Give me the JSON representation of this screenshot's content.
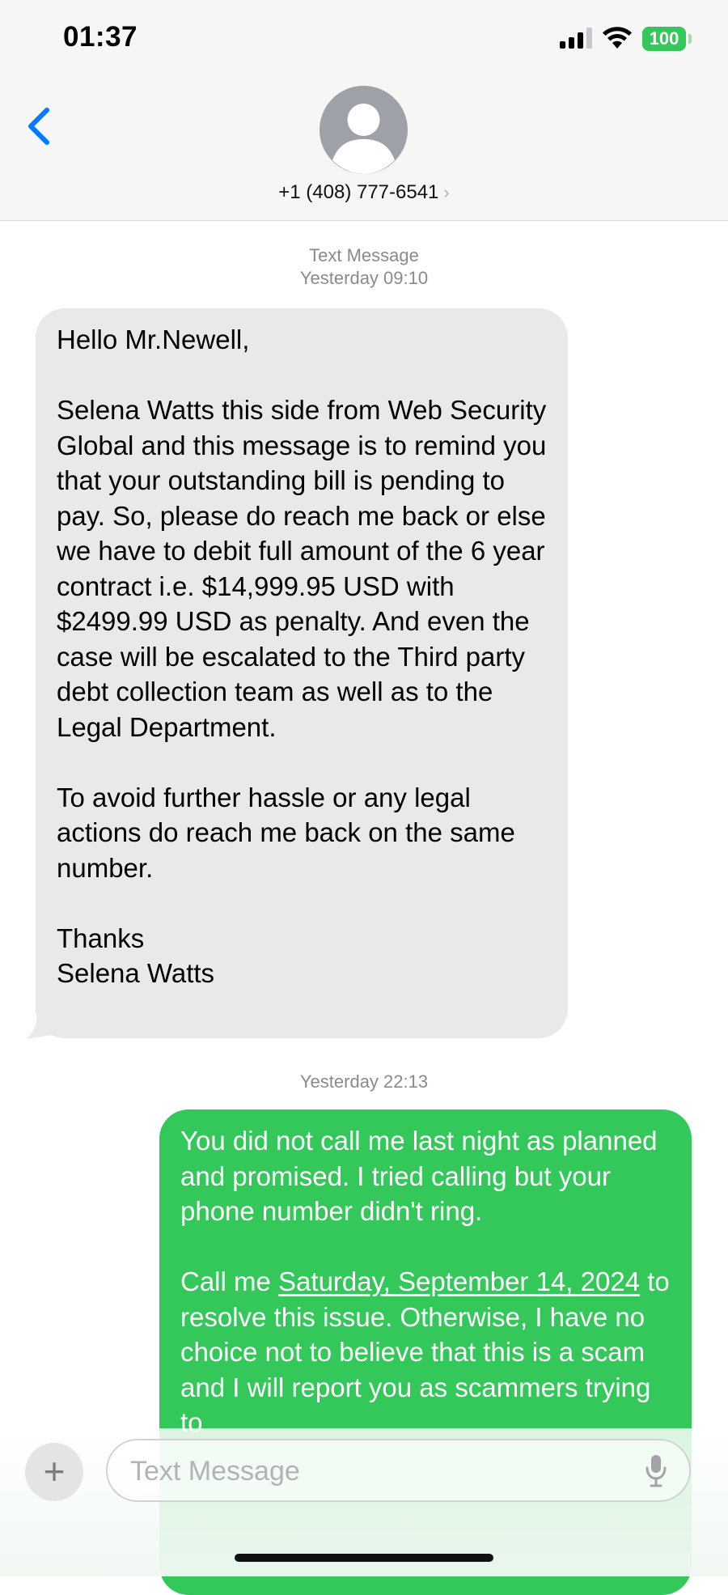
{
  "status_bar": {
    "time": "01:37",
    "battery": "100"
  },
  "header": {
    "contact": "+1 (408) 777-6541",
    "chevron": "›"
  },
  "thread": {
    "service_label": "Text Message",
    "timestamp_1": "Yesterday 09:10",
    "incoming_message": "Hello Mr.Newell,\n\nSelena Watts this side from Web Security Global and this message is to remind you that your outstanding bill is pending to pay. So, please do reach me back or else we have to debit full amount of the 6 year contract i.e. $14,999.95 USD with $2499.99 USD as penalty. And even the case will be escalated to the Third party debt collection team as well as to the Legal Department.\n\nTo avoid further hassle or any legal actions do reach me back on the same number.\n\nThanks\nSelena Watts",
    "timestamp_2": "Yesterday 22:13",
    "outgoing_part1": "You did not call me last night as planned and promised. I tried calling but your phone number didn't ring.\n\nCall me ",
    "outgoing_date_link": "Saturday, September 14, 2024",
    "outgoing_part2": " to resolve this issue. Otherwise, I have no choice not to believe that this is a scam and I will report you as scammers trying to"
  },
  "compose": {
    "plus": "+",
    "placeholder": "Text Message"
  },
  "colors": {
    "incoming_bubble": "#e9e9eb",
    "outgoing_bubble": "#34c759",
    "accent": "#007aff"
  },
  "icons": [
    "cellular-signal-icon",
    "wifi-icon",
    "battery-icon",
    "back-chevron-icon",
    "contact-avatar-icon",
    "plus-icon",
    "microphone-icon"
  ]
}
